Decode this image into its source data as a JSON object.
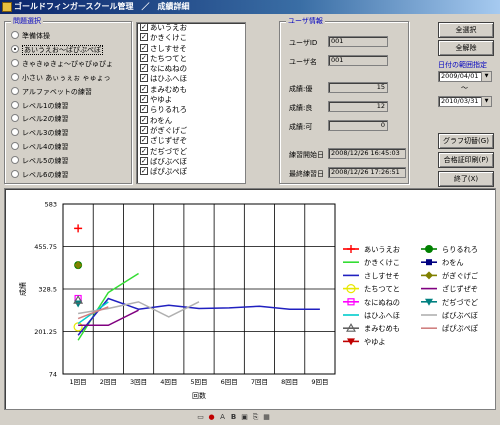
{
  "window": {
    "title": "ゴールドフィンガースクール管理　／　成績詳細"
  },
  "problem_select": {
    "label": "問題選択",
    "options": [
      {
        "label": "準備体操",
        "selected": false
      },
      {
        "label": "あいうえお～ぱぴぷぺぽ",
        "selected": true
      },
      {
        "label": "きゃきゅきょ～ぴゃぴゅぴょ",
        "selected": false
      },
      {
        "label": "小さい あぃぅぇぉ ゃゅょっ",
        "selected": false
      },
      {
        "label": "アルファベットの練習",
        "selected": false
      },
      {
        "label": "レベル1の練習",
        "selected": false
      },
      {
        "label": "レベル2の練習",
        "selected": false
      },
      {
        "label": "レベル3の練習",
        "selected": false
      },
      {
        "label": "レベル4の練習",
        "selected": false
      },
      {
        "label": "レベル5の練習",
        "selected": false
      },
      {
        "label": "レベル6の練習",
        "selected": false
      }
    ]
  },
  "student_list": {
    "items": [
      {
        "label": "あいうえお",
        "checked": true
      },
      {
        "label": "かきくけこ",
        "checked": true
      },
      {
        "label": "さしすせそ",
        "checked": true
      },
      {
        "label": "たちつてと",
        "checked": true
      },
      {
        "label": "なにぬねの",
        "checked": true
      },
      {
        "label": "はひふへほ",
        "checked": true
      },
      {
        "label": "まみむめも",
        "checked": true
      },
      {
        "label": "やゆよ",
        "checked": true
      },
      {
        "label": "らりるれろ",
        "checked": true
      },
      {
        "label": "わをん",
        "checked": true
      },
      {
        "label": "がぎぐげご",
        "checked": true
      },
      {
        "label": "ざじずぜぞ",
        "checked": true
      },
      {
        "label": "だぢづでど",
        "checked": true
      },
      {
        "label": "ばびぶべぼ",
        "checked": true
      },
      {
        "label": "ぱぴぷぺぽ",
        "checked": true
      }
    ]
  },
  "user_info": {
    "label": "ユーザ情報",
    "user_id_label": "ユーザID",
    "user_id": "001",
    "user_name_label": "ユーザ名",
    "user_name": "001",
    "grade_excellent_label": "成績:優",
    "grade_excellent": "15",
    "grade_good_label": "成績:良",
    "grade_good": "12",
    "grade_fair_label": "成績:可",
    "grade_fair": "0",
    "start_date_label": "練習開始日",
    "start_date": "2008/12/26 16:45:03",
    "last_date_label": "最終練習日",
    "last_date": "2008/12/26 17:26:51"
  },
  "buttons": {
    "select_all": "全選択",
    "clear_all": "全解除",
    "graph_toggle": "グラフ切替(G)",
    "print_certificate": "合格証印刷(P)",
    "exit": "終了(X)"
  },
  "date_range": {
    "label": "日付の範囲指定",
    "from": "2009/04/01",
    "separator": "～",
    "to": "2010/03/31"
  },
  "status_icons": [
    "new-icon",
    "record-icon",
    "font-size-icon",
    "bold-icon",
    "image-icon",
    "attach-icon",
    "caps-icon"
  ],
  "chart_data": {
    "type": "line",
    "ylabel": "成績",
    "xlabel": "回数",
    "categories": [
      "1回目",
      "2回目",
      "3回目",
      "4回目",
      "5回目",
      "6回目",
      "7回目",
      "8回目",
      "9回目"
    ],
    "yticks": [
      "583",
      "455.75",
      "328.5",
      "201.25",
      "74"
    ],
    "ylim": [
      74,
      583
    ],
    "grid": true,
    "legend_position": "right",
    "series": [
      {
        "name": "あいうえお",
        "color": "#ff0000",
        "marker": "plus",
        "values": [
          510,
          null,
          null,
          null,
          null,
          null,
          null,
          null,
          null
        ]
      },
      {
        "name": "らりるれろ",
        "color": "#008000",
        "marker": "circle",
        "values": [
          400,
          null,
          null,
          null,
          null,
          null,
          null,
          null,
          null
        ]
      },
      {
        "name": "かきくけこ",
        "color": "#33dd33",
        "marker": "none",
        "values": [
          175,
          318,
          375,
          null,
          null,
          null,
          null,
          null,
          null
        ]
      },
      {
        "name": "わをん",
        "color": "#000080",
        "marker": "square",
        "values": [
          null,
          null,
          null,
          null,
          null,
          null,
          null,
          null,
          null
        ]
      },
      {
        "name": "さしすせそ",
        "color": "#2020c0",
        "marker": "none",
        "values": [
          190,
          300,
          268,
          280,
          270,
          272,
          277,
          268,
          268
        ]
      },
      {
        "name": "がぎぐげご",
        "color": "#808000",
        "marker": "diamond",
        "values": [
          400,
          null,
          null,
          null,
          null,
          null,
          null,
          null,
          null
        ]
      },
      {
        "name": "たちつてと",
        "color": "#e8e800",
        "marker": "circle-open",
        "values": [
          215,
          null,
          null,
          null,
          null,
          null,
          null,
          null,
          null
        ]
      },
      {
        "name": "ざじずぜぞ",
        "color": "#800080",
        "marker": "none",
        "values": [
          220,
          220,
          265,
          null,
          null,
          null,
          null,
          null,
          null
        ]
      },
      {
        "name": "なにぬねの",
        "color": "#ff00ff",
        "marker": "square-open",
        "values": [
          300,
          null,
          null,
          null,
          null,
          null,
          null,
          null,
          null
        ]
      },
      {
        "name": "だぢづでど",
        "color": "#008080",
        "marker": "triangle-down",
        "values": [
          285,
          null,
          null,
          null,
          null,
          null,
          null,
          null,
          null
        ]
      },
      {
        "name": "はひふへほ",
        "color": "#00cccc",
        "marker": "none",
        "values": [
          225,
          290,
          null,
          null,
          null,
          null,
          null,
          null,
          null
        ]
      },
      {
        "name": "ばびぶべぼ",
        "color": "#b0b0b0",
        "marker": "none",
        "values": [
          255,
          270,
          290,
          245,
          290,
          null,
          null,
          null,
          null
        ]
      },
      {
        "name": "まみむめも",
        "color": "#606060",
        "marker": "triangle-open",
        "values": [
          295,
          null,
          null,
          null,
          null,
          null,
          null,
          null,
          null
        ]
      },
      {
        "name": "ぱぴぷぺぽ",
        "color": "#d08080",
        "marker": "none",
        "values": [
          240,
          275,
          null,
          null,
          null,
          null,
          null,
          null,
          null
        ]
      },
      {
        "name": "やゆよ",
        "color": "#c00000",
        "marker": "triangle-down-filled",
        "values": [
          null,
          null,
          null,
          null,
          null,
          null,
          null,
          null,
          null
        ]
      }
    ]
  }
}
